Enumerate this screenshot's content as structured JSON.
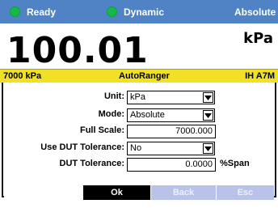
{
  "status_bar": {
    "ready_label": "Ready",
    "dynamic_label": "Dynamic",
    "absolute_label": "Absolute"
  },
  "reading": {
    "value": "100.01",
    "unit": "kPa"
  },
  "info_bar": {
    "range": "7000 kPa",
    "mode": "AutoRanger",
    "module": "IH A7M"
  },
  "form": {
    "unit": {
      "label": "Unit:",
      "value": "kPa"
    },
    "mode": {
      "label": "Mode:",
      "value": "Absolute"
    },
    "full_scale": {
      "label": "Full Scale:",
      "value": "7000.000"
    },
    "use_dut_tolerance": {
      "label": "Use DUT Tolerance:",
      "value": "No"
    },
    "dut_tolerance": {
      "label": "DUT Tolerance:",
      "value": "0.0000",
      "suffix": "%Span"
    }
  },
  "buttons": {
    "ok": "Ok",
    "back": "Back",
    "esc": "Esc"
  },
  "colors": {
    "status_bar": "#4f83c6",
    "status_dot": "#16b84a",
    "info_bar": "#f1e126",
    "button_active": "#000000",
    "button_disabled": "#b9c2e8"
  }
}
